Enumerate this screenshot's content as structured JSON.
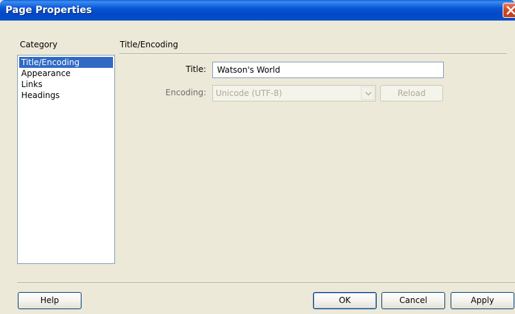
{
  "window": {
    "title": "Page Properties"
  },
  "category": {
    "label": "Category",
    "items": [
      {
        "label": "Title/Encoding",
        "selected": true
      },
      {
        "label": "Appearance",
        "selected": false
      },
      {
        "label": "Links",
        "selected": false
      },
      {
        "label": "Headings",
        "selected": false
      }
    ]
  },
  "section": {
    "title": "Title/Encoding"
  },
  "form": {
    "title_label": "Title:",
    "title_value": "Watson's World",
    "encoding_label": "Encoding:",
    "encoding_value": "Unicode (UTF-8)",
    "encoding_enabled": false,
    "reload_label": "Reload",
    "reload_enabled": false
  },
  "buttons": {
    "help": "Help",
    "ok": "OK",
    "cancel": "Cancel",
    "apply": "Apply"
  },
  "icons": {
    "close": "close-icon",
    "dropdown": "chevron-down-icon"
  },
  "colors": {
    "titlebar": "#0856D6",
    "selection": "#316AC5",
    "dialog_bg": "#ECE9D8"
  }
}
